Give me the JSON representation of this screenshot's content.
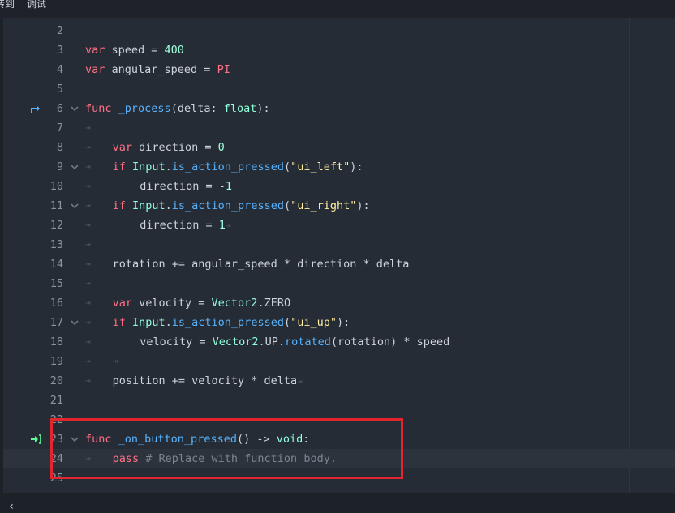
{
  "menubar": {
    "items": [
      "转到",
      "调试"
    ]
  },
  "editor": {
    "lines": [
      {
        "n": "2",
        "tokens": []
      },
      {
        "n": "3",
        "tokens": [
          [
            "kw",
            "var"
          ],
          [
            "p",
            " speed = "
          ],
          [
            "num",
            "400"
          ]
        ]
      },
      {
        "n": "4",
        "tokens": [
          [
            "kw",
            "var"
          ],
          [
            "p",
            " angular_speed = "
          ],
          [
            "const",
            "PI"
          ]
        ]
      },
      {
        "n": "5",
        "tokens": []
      },
      {
        "n": "6",
        "gutter": "override-icon",
        "fold": true,
        "tokens": [
          [
            "kw",
            "func"
          ],
          [
            "p",
            " "
          ],
          [
            "fn",
            "_process"
          ],
          [
            "p",
            "(delta: "
          ],
          [
            "ty",
            "float"
          ],
          [
            "p",
            "):"
          ]
        ]
      },
      {
        "n": "7",
        "tabs": 1,
        "tokens": []
      },
      {
        "n": "8",
        "tabs": 1,
        "indent": 1,
        "tokens": [
          [
            "kw",
            "var"
          ],
          [
            "p",
            " direction = "
          ],
          [
            "num",
            "0"
          ]
        ]
      },
      {
        "n": "9",
        "tabs": 1,
        "indent": 1,
        "fold": true,
        "tokens": [
          [
            "kw",
            "if"
          ],
          [
            "p",
            " "
          ],
          [
            "ty",
            "Input"
          ],
          [
            "p",
            "."
          ],
          [
            "fn",
            "is_action_pressed"
          ],
          [
            "p",
            "("
          ],
          [
            "str",
            "\"ui_left\""
          ],
          [
            "p",
            "):"
          ]
        ]
      },
      {
        "n": "10",
        "tabs": 1,
        "indent": 2,
        "tokens": [
          [
            "p",
            "direction = -"
          ],
          [
            "num",
            "1"
          ]
        ]
      },
      {
        "n": "11",
        "tabs": 1,
        "indent": 1,
        "fold": true,
        "tokens": [
          [
            "kw",
            "if"
          ],
          [
            "p",
            " "
          ],
          [
            "ty",
            "Input"
          ],
          [
            "p",
            "."
          ],
          [
            "fn",
            "is_action_pressed"
          ],
          [
            "p",
            "("
          ],
          [
            "str",
            "\"ui_right\""
          ],
          [
            "p",
            "):"
          ]
        ]
      },
      {
        "n": "12",
        "tabs": 1,
        "indent": 2,
        "trail": true,
        "tokens": [
          [
            "p",
            "direction = "
          ],
          [
            "num",
            "1"
          ]
        ]
      },
      {
        "n": "13",
        "tabs": 1,
        "tokens": []
      },
      {
        "n": "14",
        "tabs": 1,
        "indent": 1,
        "tokens": [
          [
            "p",
            "rotation += angular_speed * direction * delta"
          ]
        ]
      },
      {
        "n": "15",
        "tabs": 1,
        "tokens": []
      },
      {
        "n": "16",
        "tabs": 1,
        "indent": 1,
        "tokens": [
          [
            "kw",
            "var"
          ],
          [
            "p",
            " velocity = "
          ],
          [
            "ty",
            "Vector2"
          ],
          [
            "p",
            ".ZERO"
          ]
        ]
      },
      {
        "n": "17",
        "tabs": 1,
        "indent": 1,
        "fold": true,
        "tokens": [
          [
            "kw",
            "if"
          ],
          [
            "p",
            " "
          ],
          [
            "ty",
            "Input"
          ],
          [
            "p",
            "."
          ],
          [
            "fn",
            "is_action_pressed"
          ],
          [
            "p",
            "("
          ],
          [
            "str",
            "\"ui_up\""
          ],
          [
            "p",
            "):"
          ]
        ]
      },
      {
        "n": "18",
        "tabs": 1,
        "indent": 2,
        "tokens": [
          [
            "p",
            "velocity = "
          ],
          [
            "ty",
            "Vector2"
          ],
          [
            "p",
            ".UP."
          ],
          [
            "fn",
            "rotated"
          ],
          [
            "p",
            "(rotation) * speed"
          ]
        ]
      },
      {
        "n": "19",
        "tabs": 2,
        "tokens": []
      },
      {
        "n": "20",
        "tabs": 1,
        "indent": 1,
        "trail": true,
        "tokens": [
          [
            "p",
            "position += velocity * delta"
          ]
        ]
      },
      {
        "n": "21",
        "tokens": []
      },
      {
        "n": "22",
        "tokens": []
      },
      {
        "n": "23",
        "gutter": "signal-connection-icon",
        "fold": true,
        "tokens": [
          [
            "kw",
            "func"
          ],
          [
            "p",
            " "
          ],
          [
            "fn",
            "_on_button_pressed"
          ],
          [
            "p",
            "() -> "
          ],
          [
            "ty",
            "void"
          ],
          [
            "p",
            ":"
          ]
        ]
      },
      {
        "n": "24",
        "tabs": 1,
        "indent": 1,
        "current": true,
        "tokens": [
          [
            "kw",
            "pass"
          ],
          [
            "p",
            " "
          ],
          [
            "cm",
            "# Replace with function body."
          ]
        ]
      },
      {
        "n": "25",
        "tokens": []
      }
    ]
  },
  "icons": {
    "override": "override-icon",
    "signal": "signal-connection-icon",
    "fold": "chevron-down-icon",
    "tab": "tab-marker-icon",
    "scroll_left": "chevron-left-icon"
  },
  "colors": {
    "keyword": "#ff7085",
    "number": "#a1ffe0",
    "type": "#8fffdb",
    "function": "#57b3ff",
    "string": "#ffeda1",
    "comment": "#7d8590",
    "highlight_box": "#e3262d",
    "override_icon": "#57b3ff",
    "signal_icon": "#5fff97"
  }
}
